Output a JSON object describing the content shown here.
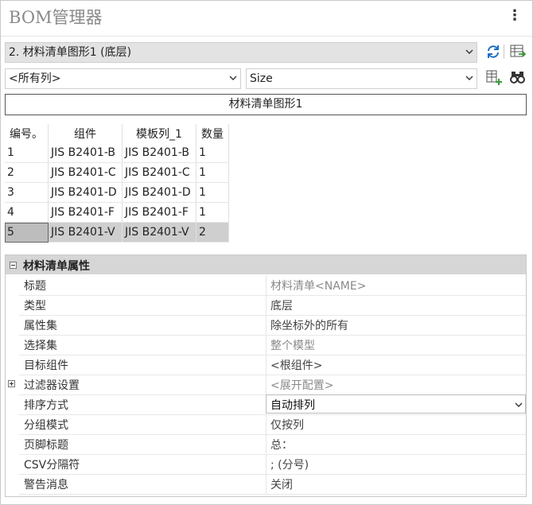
{
  "panel": {
    "title": "BOM管理器"
  },
  "toolbar": {
    "bom_select": "2. 材料清单图形1 (底层)",
    "columns_select": "<所有列>",
    "field_select": "Size"
  },
  "caption": "材料清单图形1",
  "table": {
    "headers": [
      "编号。",
      "组件",
      "模板列_1",
      "数量"
    ],
    "rows": [
      [
        "1",
        "JIS B2401-B",
        "JIS B2401-B",
        "1"
      ],
      [
        "2",
        "JIS B2401-C",
        "JIS B2401-C",
        "1"
      ],
      [
        "3",
        "JIS B2401-D",
        "JIS B2401-D",
        "1"
      ],
      [
        "4",
        "JIS B2401-F",
        "JIS B2401-F",
        "1"
      ],
      [
        "5",
        "JIS B2401-V",
        "JIS B2401-V",
        "2"
      ]
    ],
    "selected_row": 4
  },
  "properties": {
    "section_title": "材料清单属性",
    "rows": [
      {
        "key": "标题",
        "value": "材料清单<NAME>"
      },
      {
        "key": "类型",
        "value": "底层"
      },
      {
        "key": "属性集",
        "value": "除坐标外的所有"
      },
      {
        "key": "选择集",
        "value": "整个模型"
      },
      {
        "key": "目标组件",
        "value": "<根组件>"
      },
      {
        "key": "过滤器设置",
        "value": "<展开配置>"
      },
      {
        "key": "排序方式",
        "value": "自动排列"
      },
      {
        "key": "分组模式",
        "value": "仅按列"
      },
      {
        "key": "页脚标题",
        "value": "总："
      },
      {
        "key": "CSV分隔符",
        "value": "; (分号)"
      },
      {
        "key": "警告消息",
        "value": "关闭"
      }
    ]
  },
  "colors": {
    "accent_blue": "#1f6fc5",
    "accent_green": "#3a9a3a",
    "header_grey": "#d6d6d6",
    "selection_grey": "#cfcfcf"
  }
}
